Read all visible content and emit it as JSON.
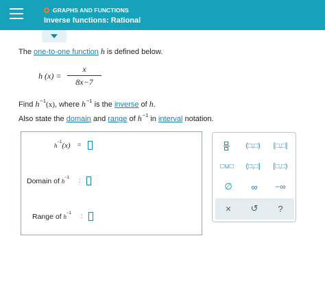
{
  "header": {
    "topic": "GRAPHS AND FUNCTIONS",
    "title": "Inverse functions: Rational",
    "accent_color": "#17a2bc",
    "ring_color": "#f47a2a"
  },
  "problem": {
    "line1_prefix": "The ",
    "line1_link": "one-to-one function",
    "line1_var": "h",
    "line1_suffix": " is defined below.",
    "formula": {
      "lhs": "h (x) =",
      "numerator": "x",
      "denominator": "8x−7"
    },
    "find": {
      "prefix": "Find ",
      "h": "h",
      "sup": "−1",
      "arg": "(x)",
      "mid": ", where ",
      "h2": "h",
      "sup2": "−1",
      "is_the": " is the ",
      "link": "inverse",
      "of": " of ",
      "h3": "h",
      "dot": "."
    },
    "state": {
      "prefix": "Also state the ",
      "domain_link": "domain",
      "and": " and ",
      "range_link": "range",
      "of": " of ",
      "h": "h",
      "sup": "−1",
      "in": " in ",
      "interval_link": "interval",
      "suffix": " notation."
    }
  },
  "answers": {
    "inverse_lhs_h": "h",
    "inverse_lhs_sup": "−1",
    "inverse_lhs_arg": "(x)",
    "inverse_op": "=",
    "domain_label": "Domain of",
    "domain_h": "h",
    "domain_sup": "−1",
    "domain_op": ":",
    "range_label": "Range of",
    "range_h": "h",
    "range_sup": "−1",
    "range_op": ":"
  },
  "keypad": {
    "open_open": "(□,□)",
    "closed_closed": "[□,□]",
    "union": "□∪□",
    "open_closed": "(□,□]",
    "closed_open": "[□,□)",
    "empty_set": "∅",
    "infinity": "∞",
    "neg_infinity": "−∞",
    "clear": "×",
    "undo": "↺",
    "help": "?"
  }
}
